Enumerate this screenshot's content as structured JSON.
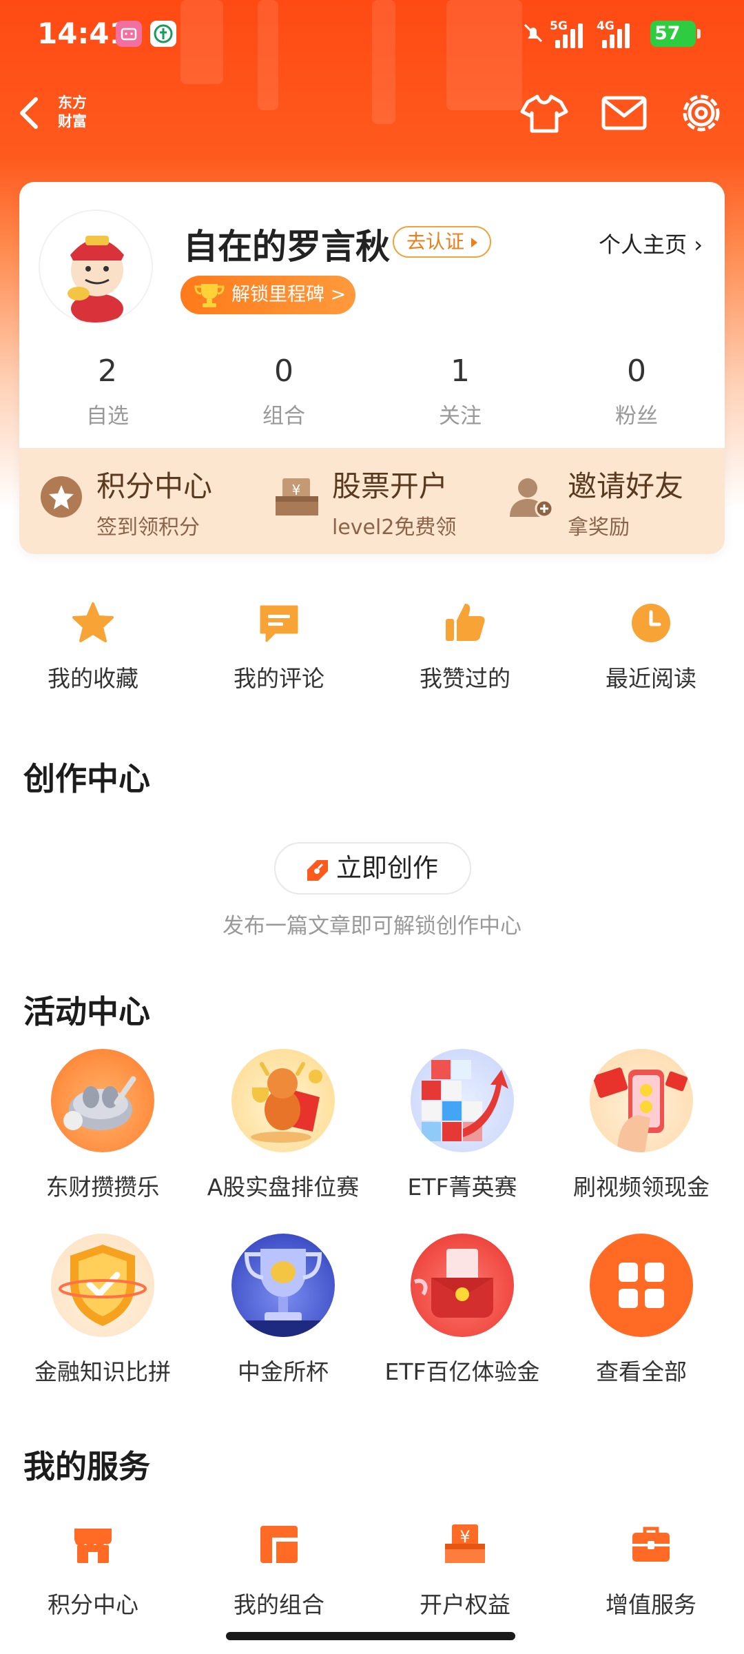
{
  "status_bar": {
    "time": "14:41",
    "network_1": "5G",
    "network_2": "4G",
    "battery": "57"
  },
  "header": {
    "logo_line1": "东方",
    "logo_line2": "财富"
  },
  "profile": {
    "username": "自在的罗言秋",
    "verify_label": "去认证",
    "homepage_label": "个人主页 ›",
    "milestone_label": "解锁里程碑 >",
    "stats": [
      {
        "value": "2",
        "label": "自选"
      },
      {
        "value": "0",
        "label": "组合"
      },
      {
        "value": "1",
        "label": "关注"
      },
      {
        "value": "0",
        "label": "粉丝"
      }
    ],
    "perks": [
      {
        "title": "积分中心",
        "subtitle": "签到领积分"
      },
      {
        "title": "股票开户",
        "subtitle": "level2免费领"
      },
      {
        "title": "邀请好友",
        "subtitle": "拿奖励"
      }
    ]
  },
  "quick_links": [
    {
      "label": "我的收藏",
      "icon": "star-icon"
    },
    {
      "label": "我的评论",
      "icon": "comment-icon"
    },
    {
      "label": "我赞过的",
      "icon": "thumbs-up-icon"
    },
    {
      "label": "最近阅读",
      "icon": "clock-icon"
    }
  ],
  "creation": {
    "section_title": "创作中心",
    "create_button": "立即创作",
    "hint": "发布一篇文章即可解锁创作中心"
  },
  "activities": {
    "section_title": "活动中心",
    "items": [
      {
        "label": "东财攒攒乐"
      },
      {
        "label": "A股实盘排位赛"
      },
      {
        "label": "ETF菁英赛"
      },
      {
        "label": "刷视频领现金"
      },
      {
        "label": "金融知识比拼"
      },
      {
        "label": "中金所杯"
      },
      {
        "label": "ETF百亿体验金"
      },
      {
        "label": "查看全部"
      }
    ]
  },
  "services": {
    "section_title": "我的服务",
    "items": [
      {
        "label": "积分中心",
        "icon": "store-icon"
      },
      {
        "label": "我的组合",
        "icon": "portfolio-icon"
      },
      {
        "label": "开户权益",
        "icon": "account-benefit-icon"
      },
      {
        "label": "增值服务",
        "icon": "briefcase-icon"
      }
    ]
  },
  "colors": {
    "brand_orange": "#ff5a1e",
    "accent_icon": "#f7a336",
    "perk_bg": "#fde6d0"
  }
}
